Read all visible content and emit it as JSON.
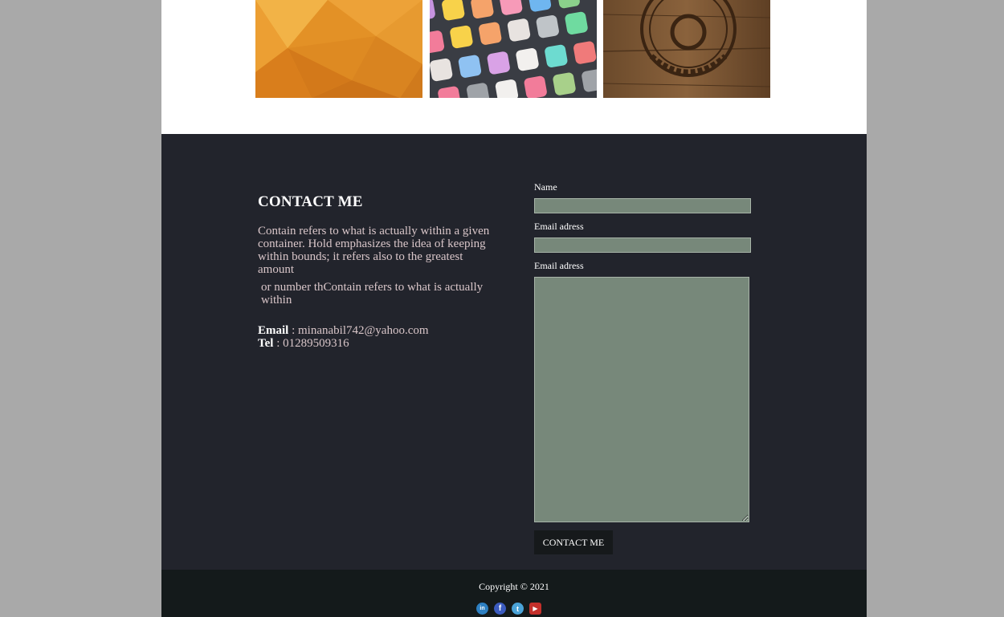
{
  "portfolio": {
    "items": [
      {
        "alt": "orange-polygon-image"
      },
      {
        "alt": "app-icons-image"
      },
      {
        "alt": "burned-logo-mockup-image"
      }
    ]
  },
  "contact": {
    "title": "CONTACT ME",
    "paragraph_1": "Contain refers to what is actually within a given container. Hold emphasizes the idea of keeping within bounds; it refers also to the greatest amount",
    "paragraph_2": "or number thContain refers to what is actually within",
    "email_label": "Email",
    "email_value": " : minanabil742@yahoo.com",
    "tel_label": "Tel",
    "tel_value": " : 01289509316"
  },
  "form": {
    "name_label": "Name",
    "email_label": "Email adress",
    "message_label": "Email adress",
    "submit_label": "CONTACT ME"
  },
  "footer": {
    "copyright": "Copyright © 2021",
    "socials": [
      {
        "icon": "linkedin-icon",
        "glyph": "in"
      },
      {
        "icon": "facebook-icon",
        "glyph": "f"
      },
      {
        "icon": "twitter-icon",
        "glyph": "t"
      },
      {
        "icon": "youtube-icon",
        "glyph": "▶"
      }
    ]
  },
  "colors": {
    "page_bg": "#a9a9a9",
    "contact_bg": "#22242c",
    "footer_bg": "#141a1b",
    "input_bg": "#77887a",
    "button_bg": "#16191b",
    "body_text": "#d9c6c9"
  }
}
